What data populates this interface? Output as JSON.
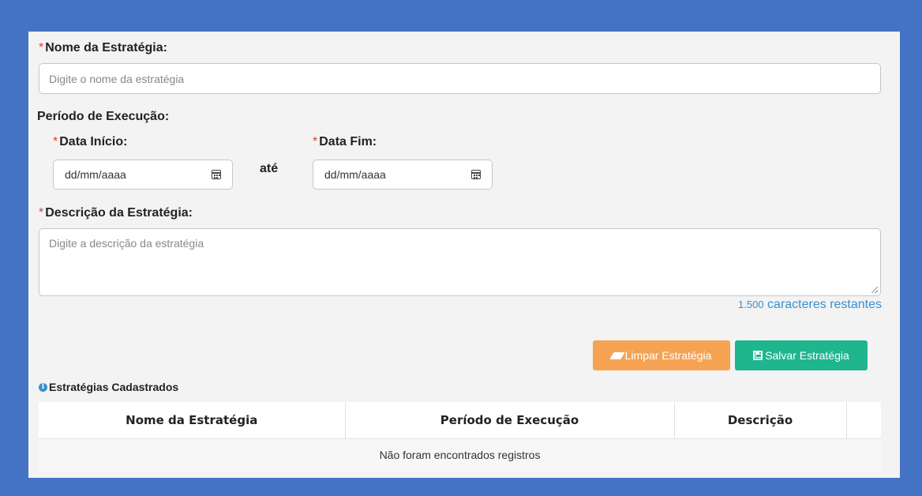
{
  "form": {
    "required_mark": "*",
    "name_label": "Nome da Estratégia:",
    "name_placeholder": "Digite o nome da estratégia",
    "period_label": "Período de Execução:",
    "start_label": "Data Início:",
    "start_value": "dd/mm/aaaa",
    "until_label": "até",
    "end_label": "Data Fim:",
    "end_value": "dd/mm/aaaa",
    "desc_label": "Descrição da Estratégia:",
    "desc_placeholder": "Digite a descrição da estratégia",
    "remaining_count": "1.500",
    "remaining_text": "caracteres restantes"
  },
  "buttons": {
    "clear_label": "Limpar Estratégia",
    "save_label": "Salvar Estratégia",
    "clear_color": "#f5a353",
    "save_color": "#1fb58f"
  },
  "table": {
    "title": "Estratégias Cadastrados",
    "columns": [
      "Nome da Estratégia",
      "Período de Execução",
      "Descrição",
      ""
    ],
    "empty_message": "Não foram encontrados registros"
  },
  "icons": {
    "calendar": "calendar-icon",
    "eraser": "eraser-icon",
    "save": "save-icon",
    "info": "info-icon"
  },
  "colors": {
    "background": "#4472c4",
    "required": "#e0403a",
    "counter": "#3a8fcf"
  }
}
